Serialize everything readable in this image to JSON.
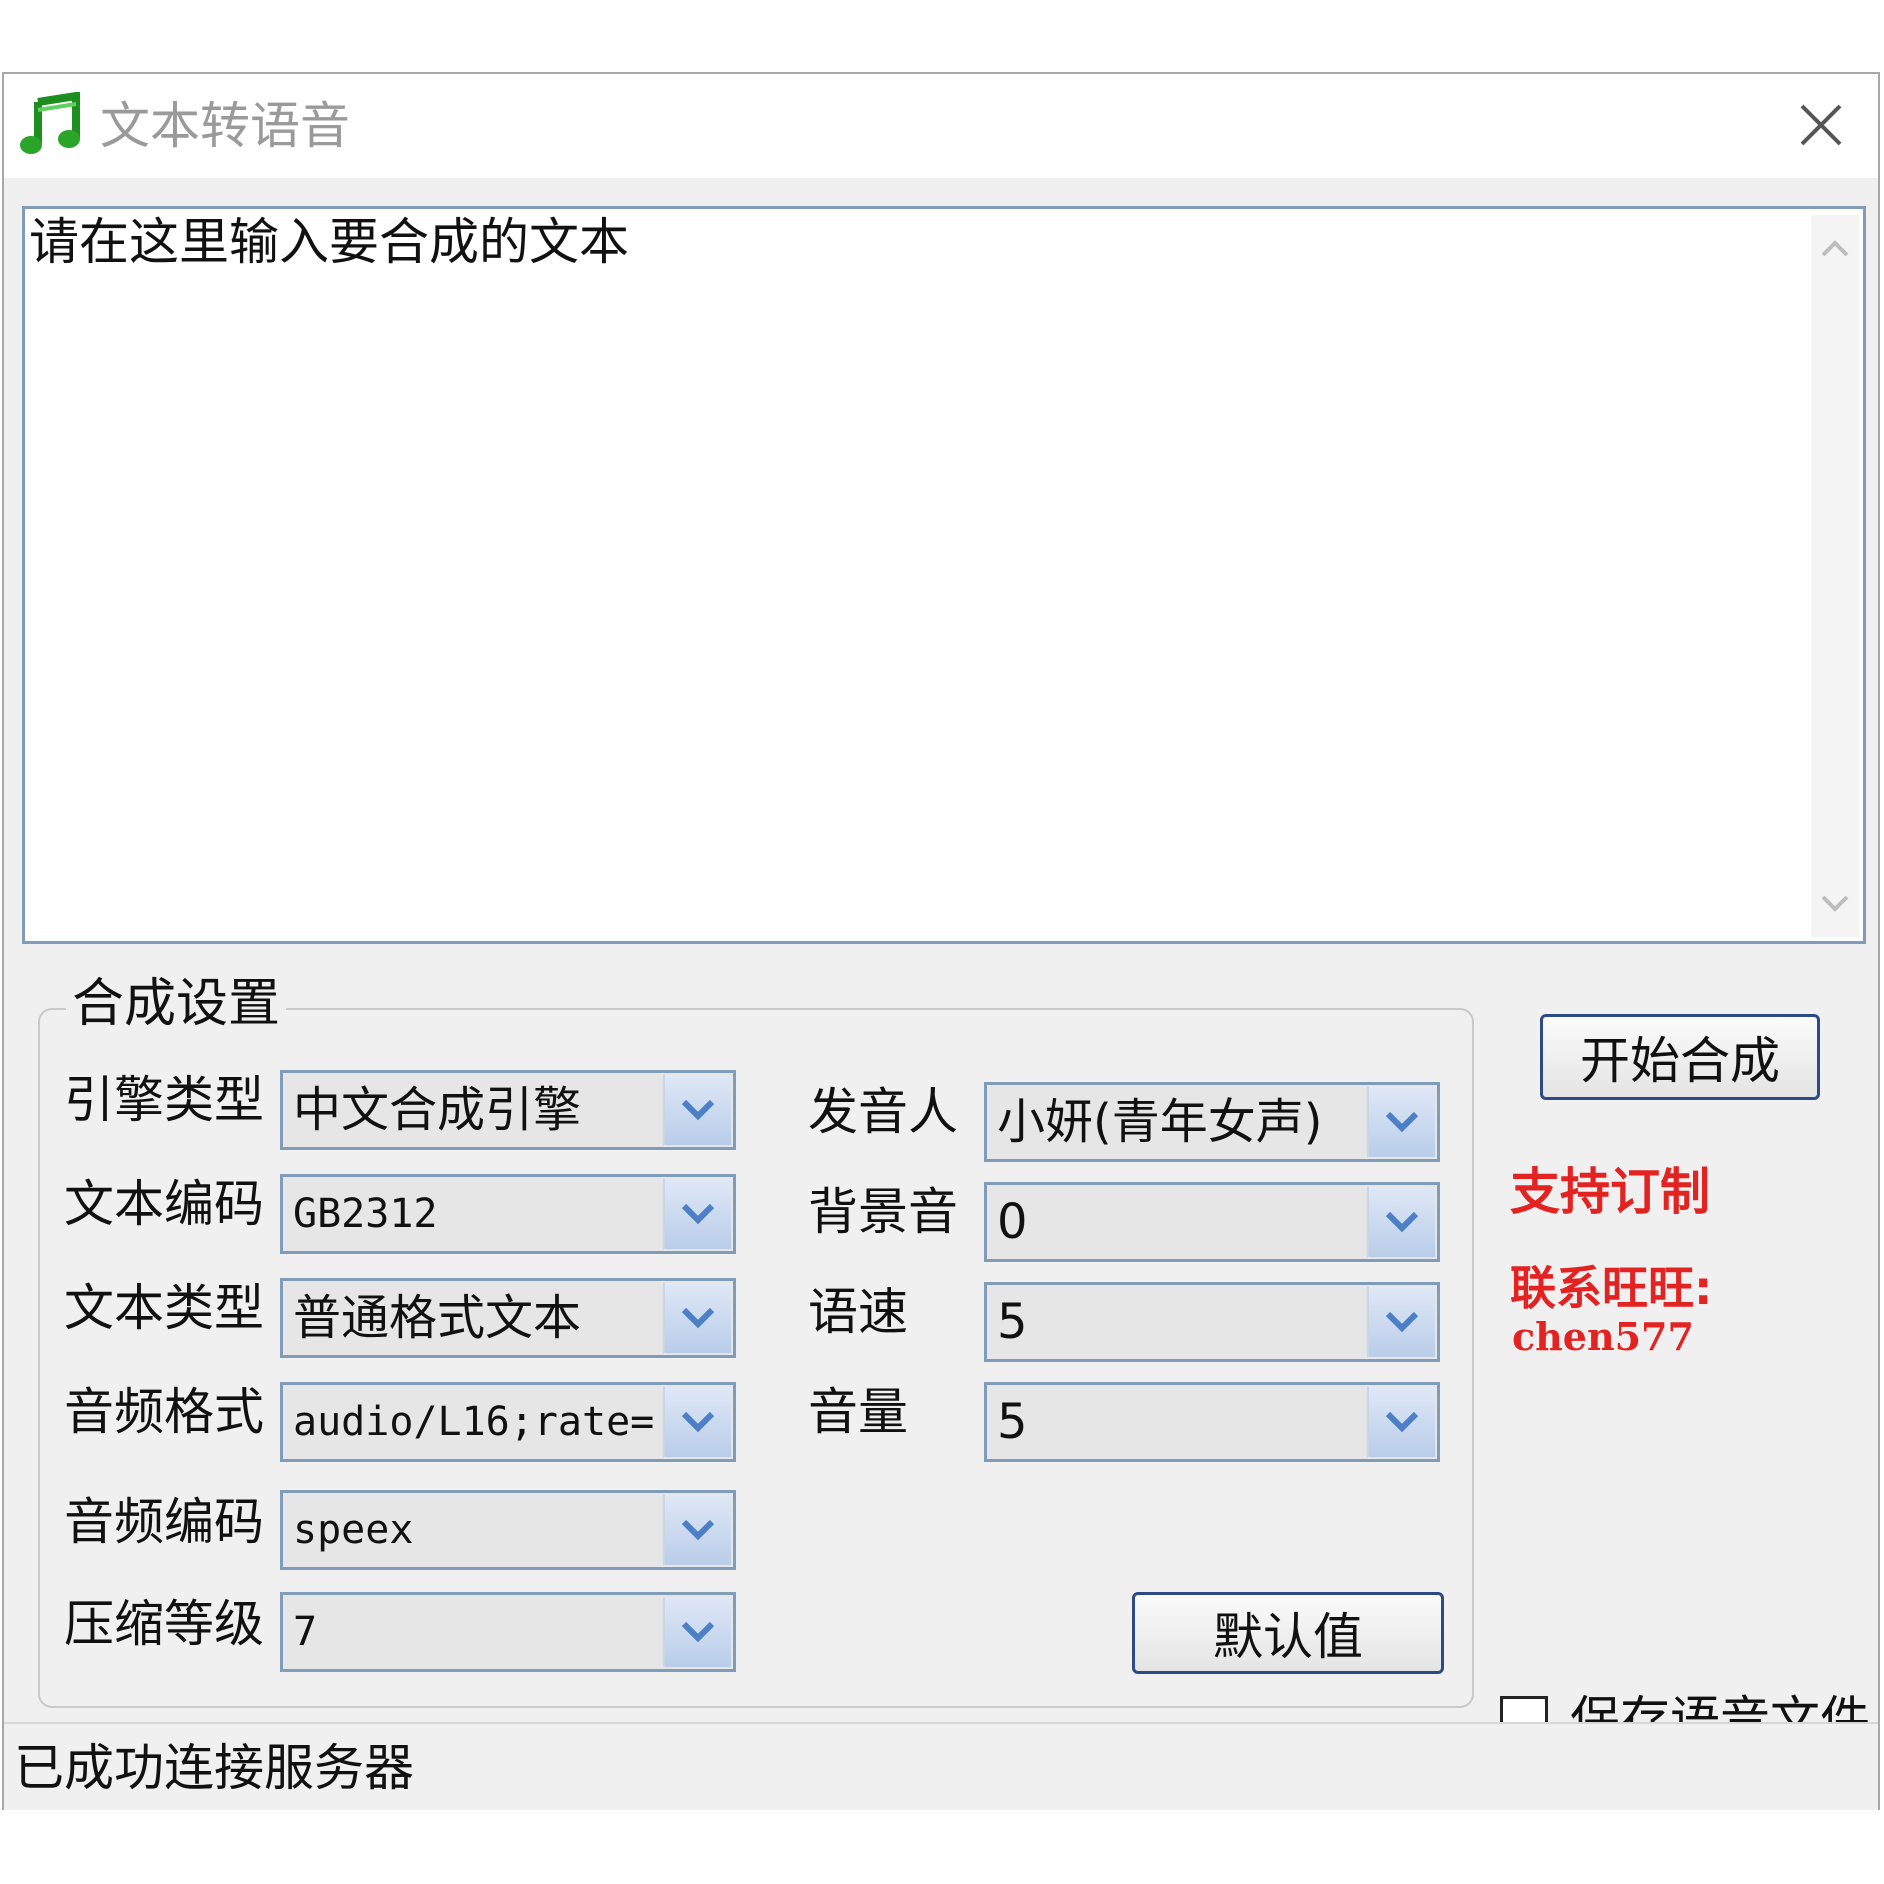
{
  "window": {
    "title": "文本转语音"
  },
  "editor": {
    "text": "请在这里输入要合成的文本"
  },
  "settings": {
    "group_title": "合成设置",
    "left": [
      {
        "label": "引擎类型",
        "value": "中文合成引擎"
      },
      {
        "label": "文本编码",
        "value": "GB2312"
      },
      {
        "label": "文本类型",
        "value": "普通格式文本"
      },
      {
        "label": "音频格式",
        "value": "audio/L16;rate="
      },
      {
        "label": "音频编码",
        "value": "speex"
      },
      {
        "label": "压缩等级",
        "value": "7"
      }
    ],
    "right": [
      {
        "label": "发音人",
        "value": "小妍(青年女声)"
      },
      {
        "label": "背景音",
        "value": "0"
      },
      {
        "label": "语速",
        "value": "5"
      },
      {
        "label": "音量",
        "value": "5"
      }
    ],
    "default_button": "默认值"
  },
  "actions": {
    "start_button": "开始合成",
    "support_text": "支持订制",
    "contact_label": "联系旺旺:",
    "contact_id": "chen577",
    "save_checkbox_label": "保存语音文件",
    "save_checked": false
  },
  "status": {
    "text": "已成功连接服务器"
  },
  "colors": {
    "accent_red": "#e32222",
    "combo_border": "#7f9db9",
    "button_border": "#2b4a86"
  }
}
